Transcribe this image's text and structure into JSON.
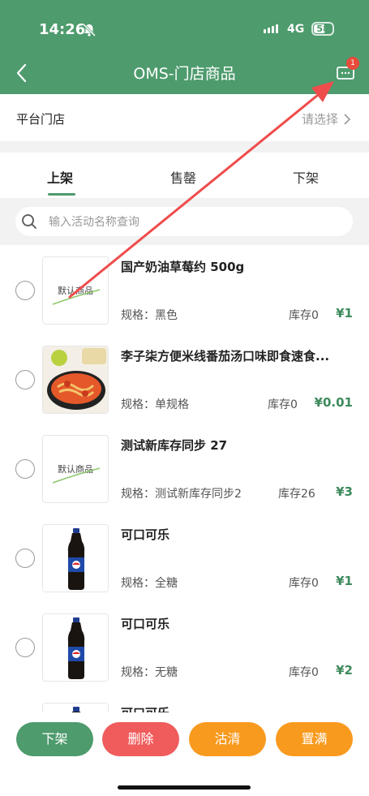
{
  "status_bar": {
    "time": "14:26",
    "network": "4G",
    "battery": "58"
  },
  "nav": {
    "title": "OMS-门店商品",
    "badge_count": "1"
  },
  "store": {
    "label": "平台门店",
    "placeholder": "请选择"
  },
  "tabs": [
    {
      "label": "上架",
      "active": true
    },
    {
      "label": "售罄",
      "active": false
    },
    {
      "label": "下架",
      "active": false
    }
  ],
  "search": {
    "placeholder": "输入活动名称查询"
  },
  "products": [
    {
      "name": "国产奶油草莓约 500g",
      "spec": "规格：黑色",
      "stock": "库存0",
      "price": "¥1",
      "image": "placeholder",
      "placeholder_text": "默认商品"
    },
    {
      "name": "李子柒方便米线番茄汤口味即食速食...",
      "spec": "规格：单规格",
      "stock": "库存0",
      "price": "¥0.01",
      "image": "noodle-bowl"
    },
    {
      "name": "测试新库存同步 27",
      "spec": "规格：测试新库存同步2",
      "stock": "库存26",
      "price": "¥3",
      "image": "placeholder",
      "placeholder_text": "默认商品"
    },
    {
      "name": "可口可乐",
      "spec": "规格：全糖",
      "stock": "库存0",
      "price": "¥1",
      "image": "cola-bottle"
    },
    {
      "name": "可口可乐",
      "spec": "规格：无糖",
      "stock": "库存0",
      "price": "¥2",
      "image": "cola-bottle"
    },
    {
      "name": "可口可乐",
      "image": "cola-bottle"
    }
  ],
  "actions": {
    "off_shelf": "下架",
    "delete": "删除",
    "sold_out": "沽清",
    "restock": "置满"
  },
  "colors": {
    "primary": "#4e9b6d",
    "danger": "#f05b5b",
    "warning": "#f89a1e",
    "price": "#3d8a5c"
  }
}
